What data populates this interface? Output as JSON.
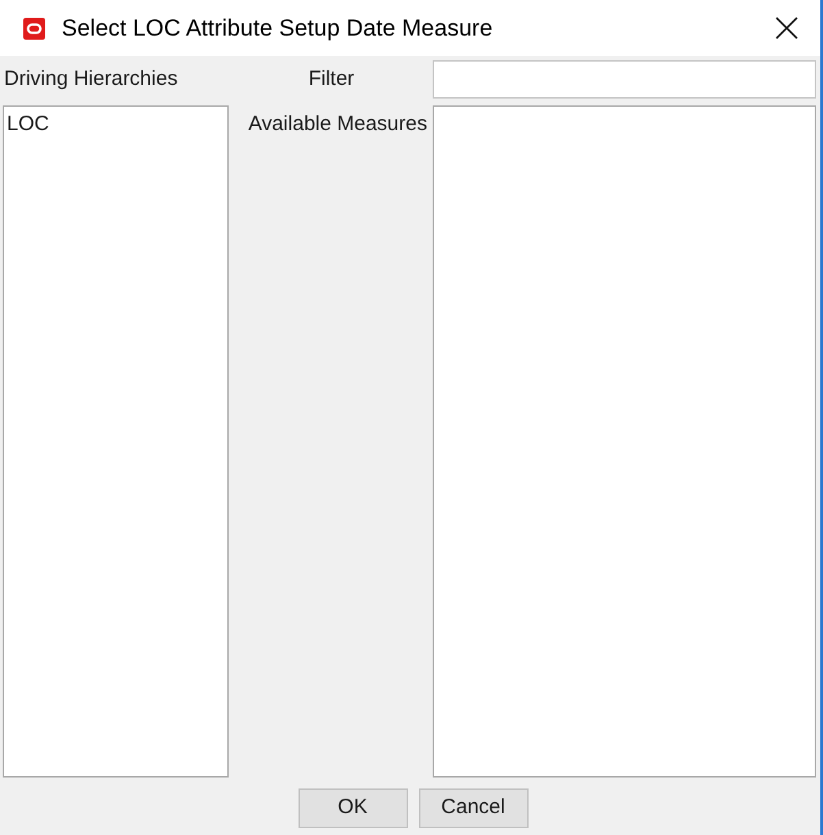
{
  "window": {
    "title": "Select LOC Attribute Setup Date Measure"
  },
  "driving_hierarchies": {
    "label": "Driving Hierarchies",
    "items": [
      {
        "label": "LOC",
        "selected": false
      }
    ]
  },
  "filter": {
    "label": "Filter"
  },
  "available_measures": {
    "label": "Available Measures"
  },
  "buttons": [
    {
      "label": "OK"
    },
    {
      "label": "Cancel"
    }
  ]
}
